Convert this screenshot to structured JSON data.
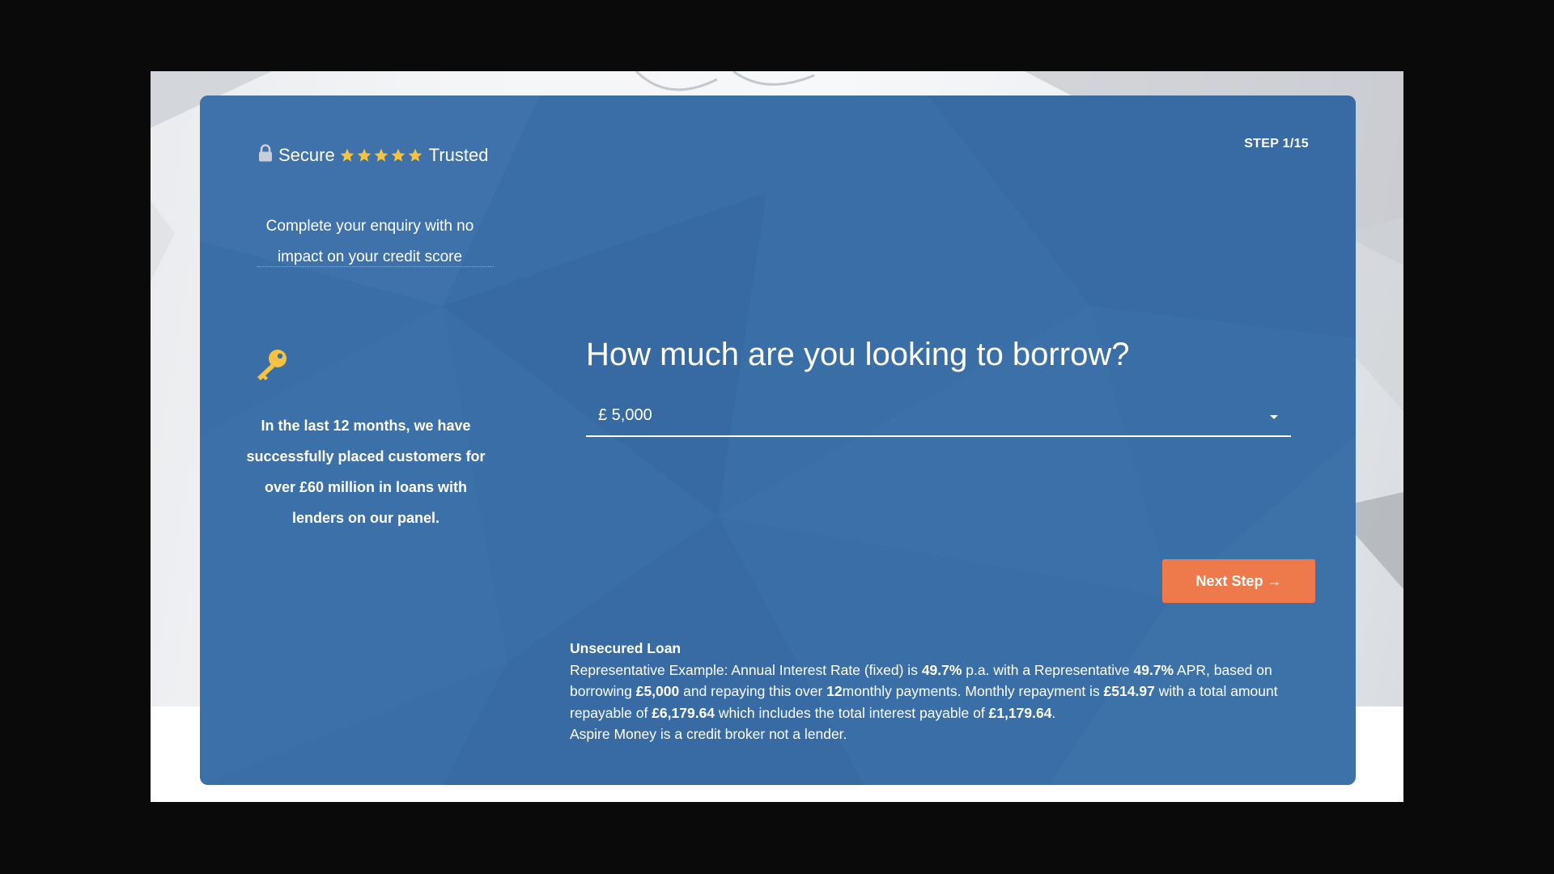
{
  "trust": {
    "secure": "Secure",
    "trusted": "Trusted",
    "star_count": 5,
    "star_color": "#f5c242",
    "lock_icon": "lock-icon",
    "star_icon": "star-icon"
  },
  "intro": "Complete your enquiry with no impact on your credit score",
  "stat": {
    "icon": "key-icon",
    "icon_color": "#f5c242",
    "text": "In the last 12 months, we have successfully placed customers for over £60 million in loans with lenders on our panel."
  },
  "step_label": "STEP 1/15",
  "question": "How much are you looking to borrow?",
  "amount_select": {
    "selected": "£ 5,000",
    "icon": "chevron-down-icon"
  },
  "next_button": "Next Step →",
  "colors": {
    "card": "#3a6ea6",
    "button": "#ee7a4c",
    "accent": "#f5c242"
  },
  "disclaimer": {
    "heading": "Unsecured Loan",
    "rep_prefix": "Representative Example: Annual Interest Rate (fixed) is ",
    "interest_rate": "49.7%",
    "rep_mid1": " p.a. with a Representative ",
    "apr": "49.7%",
    "rep_mid2": " APR, based on borrowing ",
    "amount": "£5,000",
    "rep_mid3": " and repaying this over ",
    "term": "12",
    "rep_mid4": "monthly payments. Monthly repayment is ",
    "monthly": "£514.97",
    "rep_mid5": " with a total amount repayable of ",
    "total": "£6,179.64",
    "rep_mid6": " which includes the total interest payable of ",
    "interest_total": "£1,179.64",
    "rep_end": ".",
    "broker_note": "Aspire Money is a credit broker not a lender."
  }
}
